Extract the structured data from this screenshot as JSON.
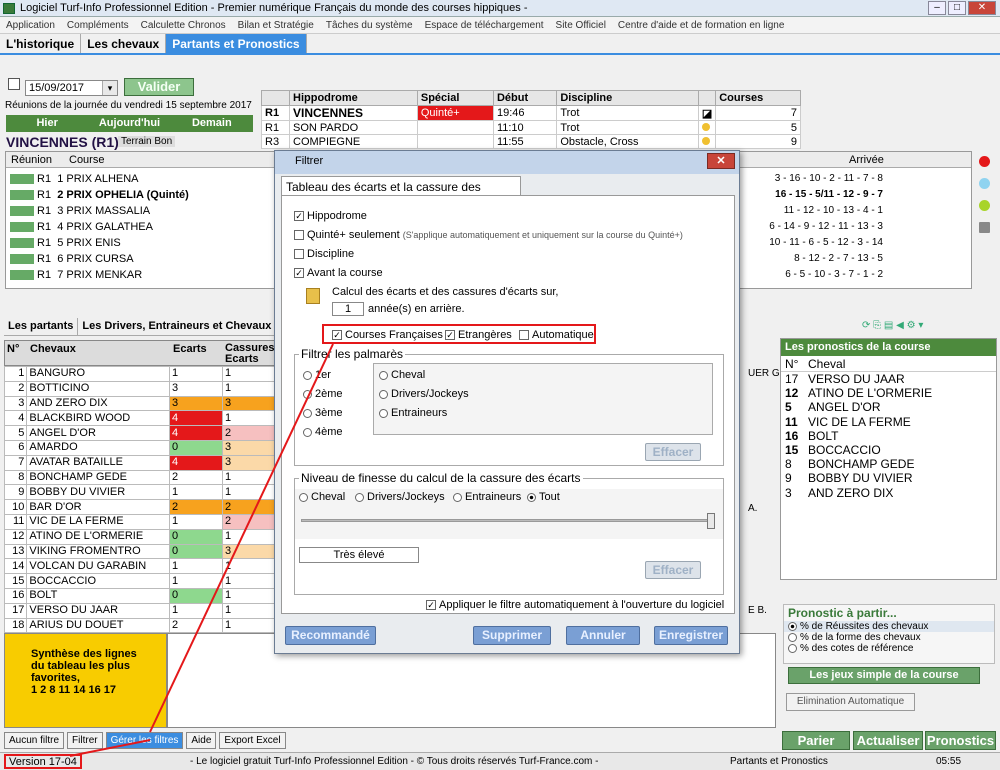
{
  "window": {
    "title": "Logiciel Turf-Info Professionnel Edition - Premier numérique Français du monde des courses hippiques -"
  },
  "menu": [
    "Application",
    "Compléments",
    "Calculette Chronos",
    "Bilan et Stratégie",
    "Tâches du système",
    "Espace de téléchargement",
    "Site Officiel",
    "Centre d'aide et de formation en ligne"
  ],
  "tabs": [
    "L'historique",
    "Les chevaux",
    "Partants et Pronostics"
  ],
  "date": "15/09/2017",
  "valider": "Valider",
  "reunions_label": "Réunions de la journée du vendredi 15 septembre 2017",
  "nav": [
    "Hier",
    "Aujourd'hui",
    "Demain"
  ],
  "venue": "VINCENNES (R1)",
  "terrain": "Terrain Bon",
  "hipp": {
    "headers": [
      "Hippodrome",
      "Spécial",
      "Début",
      "Discipline",
      "Courses"
    ],
    "rows": [
      [
        "R1",
        "VINCENNES",
        "Quinté+",
        "19:46",
        "Trot",
        "7"
      ],
      [
        "R1",
        "SON PARDO",
        "",
        "11:10",
        "Trot",
        "5"
      ],
      [
        "R3",
        "COMPIEGNE",
        "",
        "11:55",
        "Obstacle, Cross",
        "9"
      ]
    ]
  },
  "courses": {
    "h_reunion": "Réunion",
    "h_course": "Course",
    "h_arrivee": "Arrivée",
    "rows": [
      [
        "R1",
        "1 PRIX ALHENA",
        "3 - 16 - 10 - 2 - 11 - 7 - 8"
      ],
      [
        "R1",
        "2 PRIX OPHELIA (Quinté)",
        "16 - 15 - 5/11 - 12 - 9 - 7"
      ],
      [
        "R1",
        "3 PRIX MASSALIA",
        "11 - 12 - 10 - 13 - 4 - 1"
      ],
      [
        "R1",
        "4 PRIX GALATHEA",
        "6 - 14 - 9 - 12 - 11 - 13 - 3"
      ],
      [
        "R1",
        "5 PRIX ENIS",
        "10 - 11 - 6 - 5 - 12 - 3 - 14"
      ],
      [
        "R1",
        "6 PRIX CURSA",
        "8 - 12 - 2 - 7 - 13 - 5"
      ],
      [
        "R1",
        "7 PRIX MENKAR",
        "6 - 5 - 10 - 3 - 7 - 1 - 2"
      ]
    ]
  },
  "subtabs": [
    "Les partants",
    "Les Drivers, Entraineurs et Chevaux",
    "Ta"
  ],
  "main": {
    "headers": [
      "N°",
      "Chevaux",
      "Ecarts",
      "Cassures Ecarts"
    ],
    "rows": [
      [
        "1",
        "BANGURO",
        "1",
        "1"
      ],
      [
        "2",
        "BOTTICINO",
        "3",
        "1"
      ],
      [
        "3",
        "AND ZERO DIX",
        "3",
        "3"
      ],
      [
        "4",
        "BLACKBIRD WOOD",
        "4",
        "1"
      ],
      [
        "5",
        "ANGEL D'OR",
        "4",
        "2"
      ],
      [
        "6",
        "AMARDO",
        "0",
        "3"
      ],
      [
        "7",
        "AVATAR BATAILLE",
        "4",
        "3"
      ],
      [
        "8",
        "BONCHAMP GEDE",
        "2",
        "1"
      ],
      [
        "9",
        "BOBBY DU VIVIER",
        "1",
        "1"
      ],
      [
        "10",
        "BAR D'OR",
        "2",
        "2"
      ],
      [
        "11",
        "VIC DE LA FERME",
        "1",
        "2"
      ],
      [
        "12",
        "ATINO DE L'ORMERIE",
        "0",
        "1"
      ],
      [
        "13",
        "VIKING FROMENTRO",
        "0",
        "3"
      ],
      [
        "14",
        "VOLCAN DU GARABIN",
        "1",
        "1"
      ],
      [
        "15",
        "BOCCACCIO",
        "1",
        "1"
      ],
      [
        "16",
        "BOLT",
        "0",
        "1"
      ],
      [
        "17",
        "VERSO DU JAAR",
        "1",
        "1"
      ],
      [
        "18",
        "ARIUS DU DOUET",
        "2",
        "1"
      ]
    ],
    "synthese": [
      "Synthèse des lignes",
      "du tableau les plus",
      "favorites,",
      "1 2 8 11 14 16 17"
    ]
  },
  "bottom_buttons": [
    "Aucun filtre",
    "Filtrer",
    "Gérer les filtres",
    "Aide",
    "Export Excel"
  ],
  "status": {
    "version": "Version 17-04",
    "center": "- Le logiciel gratuit Turf-Info Professionnel Edition - © Tous droits réservés Turf-France.com -",
    "right": "Partants et Pronostics",
    "time": "05:55"
  },
  "pronos": {
    "title": "Les pronostics de la course",
    "h_num": "N°",
    "h_cheval": "Cheval",
    "rows": [
      [
        "17",
        "VERSO DU JAAR"
      ],
      [
        "12",
        "ATINO DE L'ORMERIE"
      ],
      [
        "5",
        "ANGEL D'OR"
      ],
      [
        "11",
        "VIC DE LA FERME"
      ],
      [
        "16",
        "BOLT"
      ],
      [
        "15",
        "BOCCACCIO"
      ],
      [
        "8",
        "BONCHAMP GEDE"
      ],
      [
        "9",
        "BOBBY DU VIVIER"
      ],
      [
        "3",
        "AND ZERO DIX"
      ]
    ]
  },
  "partir": {
    "title": "Pronostic à partir...",
    "opts": [
      "% de Réussites des chevaux",
      "% de la forme des chevaux",
      "% des cotes de référence"
    ],
    "jeux": "Les jeux simple de la course",
    "elim": "Elimination Automatique"
  },
  "actions": [
    "Parier",
    "Actualiser",
    "Pronostics"
  ],
  "right_cut": [
    "UER G.",
    "A.",
    "E B."
  ],
  "filter": {
    "title": "Filtrer",
    "tab": "Tableau des écarts et la cassure des écarts",
    "hippodrome": "Hippodrome",
    "quinte": "Quinté+ seulement",
    "quinte_note": "(S'applique automatiquement et uniquement sur la course du Quinté+)",
    "discipline": "Discipline",
    "avant": "Avant la course",
    "calc_label": "Calcul des écarts et des cassures d'écarts sur,",
    "years": "1",
    "years_label": "année(s) en arrière.",
    "courses_fr": "Courses Françaises",
    "etrangeres": "Etrangères",
    "auto": "Automatique",
    "palm_title": "Filtrer les palmarès",
    "places": [
      "1er",
      "2ème",
      "3ème",
      "4ème"
    ],
    "palm_opts": [
      "Cheval",
      "Drivers/Jockeys",
      "Entraineurs"
    ],
    "effacer": "Effacer",
    "fin_title": "Niveau de finesse du calcul de la cassure des écarts",
    "fin_opts": [
      "Cheval",
      "Drivers/Jockeys",
      "Entraineurs",
      "Tout"
    ],
    "niveau": "Très élevé",
    "appliquer": "Appliquer le filtre automatiquement à l'ouverture du logiciel",
    "buttons": [
      "Recommandé",
      "Supprimer",
      "Annuler",
      "Enregistrer"
    ]
  }
}
